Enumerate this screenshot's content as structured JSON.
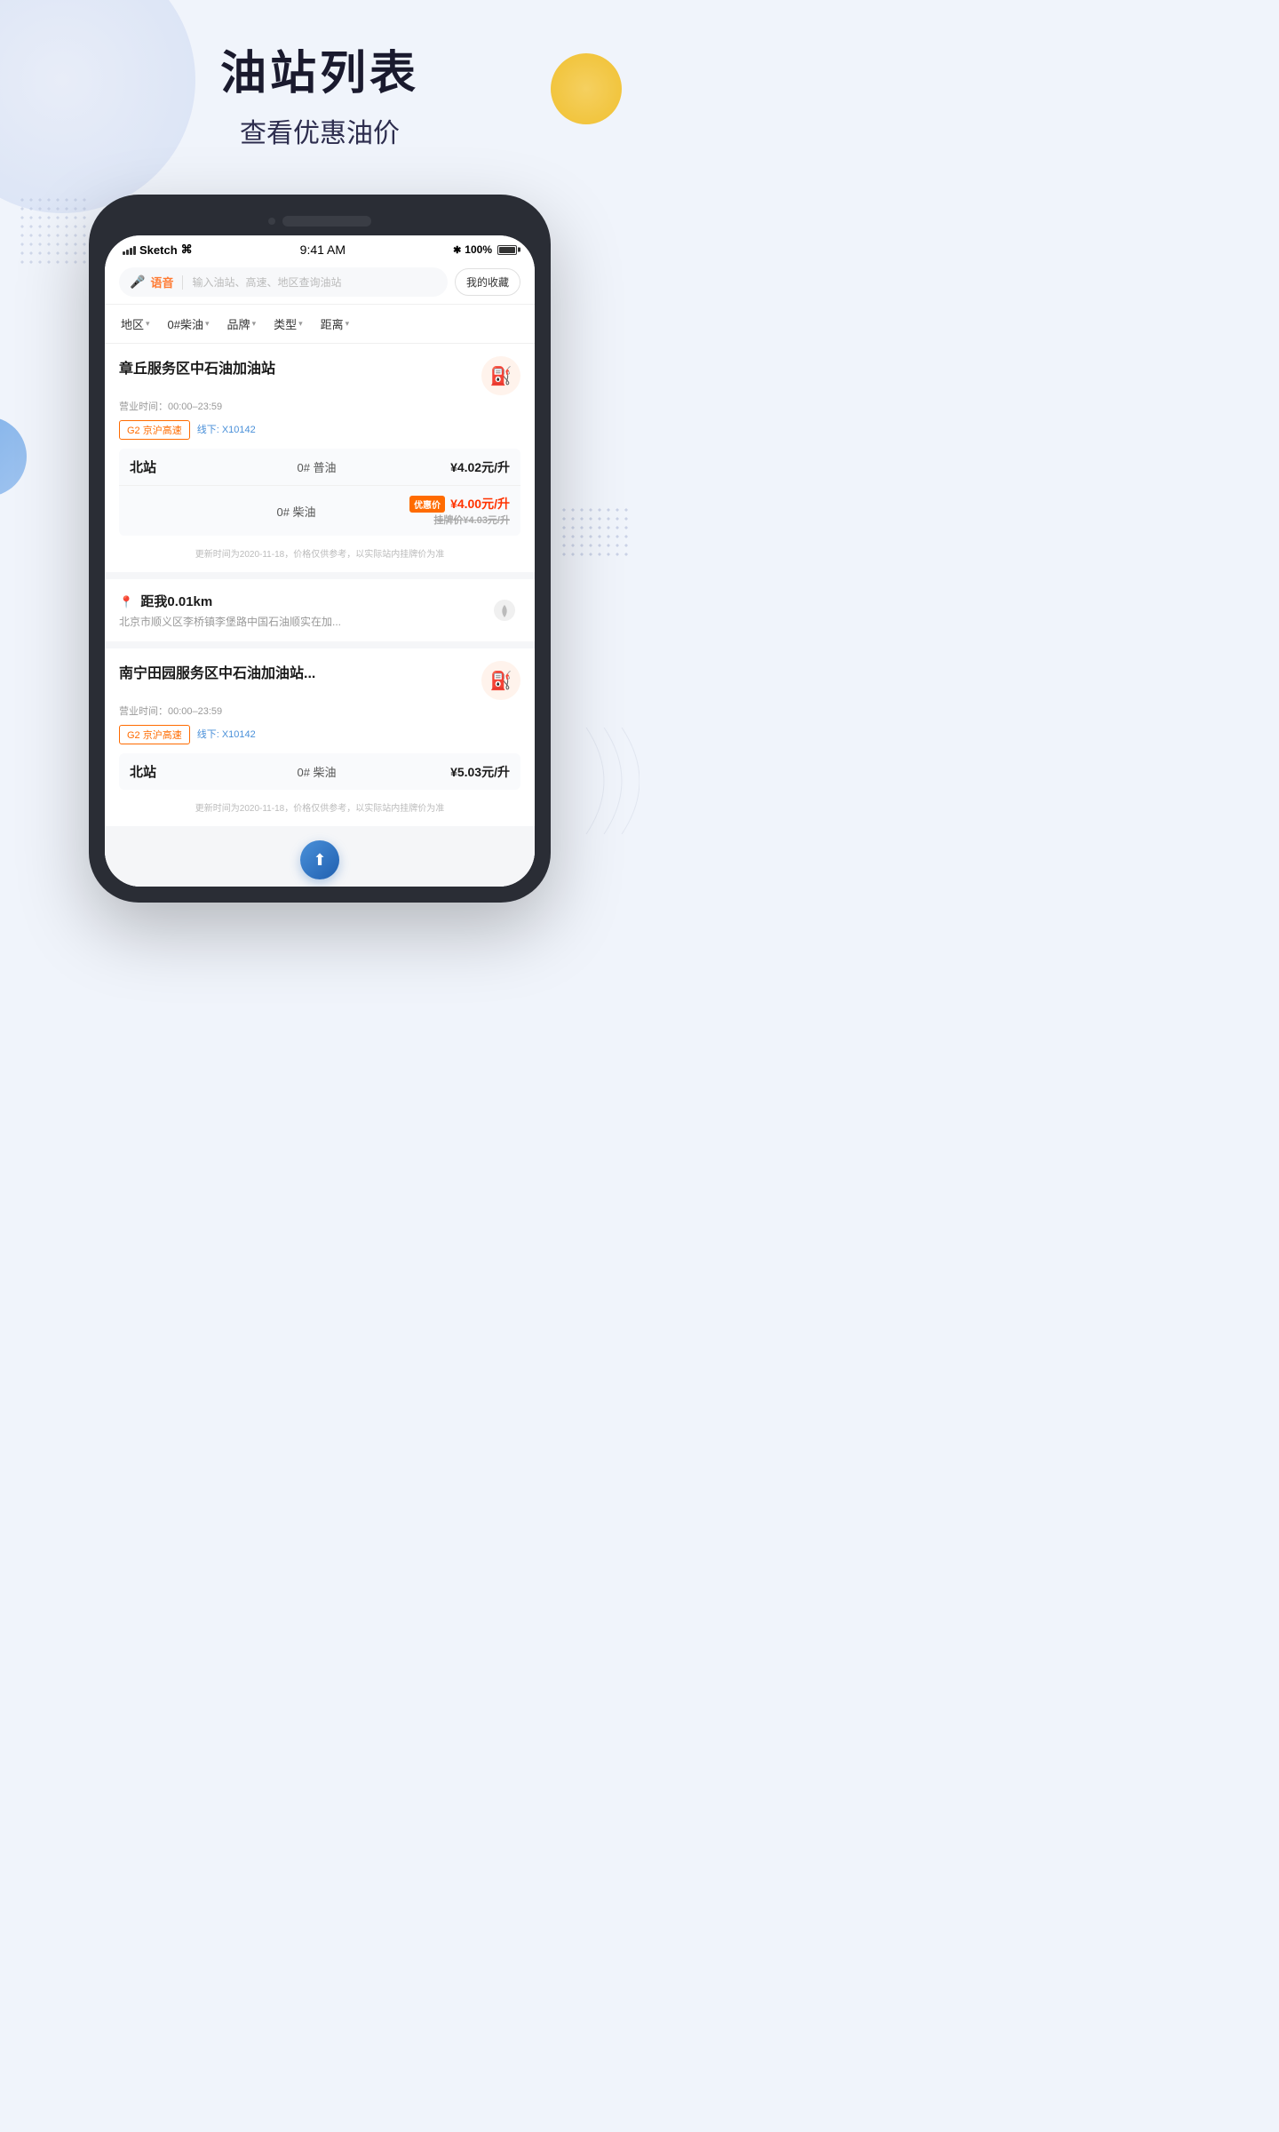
{
  "page": {
    "title": "油站列表",
    "subtitle": "查看优惠油价"
  },
  "status_bar": {
    "carrier": "Sketch",
    "time": "9:41 AM",
    "battery": "100%",
    "bluetooth": "✱"
  },
  "search": {
    "voice_label": "语音",
    "placeholder": "输入油站、高速、地区查询油站",
    "favorites_label": "我的收藏"
  },
  "filters": [
    {
      "label": "地区",
      "id": "region"
    },
    {
      "label": "0#柴油",
      "id": "fuel-type"
    },
    {
      "label": "品牌",
      "id": "brand"
    },
    {
      "label": "类型",
      "id": "type"
    },
    {
      "label": "距离",
      "id": "distance"
    }
  ],
  "stations": [
    {
      "id": "station-1",
      "name": "章丘服务区中石油加油站",
      "hours": "营业时间：00:00–23:59",
      "tag_highway": "G2 京沪高速",
      "tag_line": "线下: X10142",
      "sub_station": "北站",
      "prices": [
        {
          "fuel": "0# 普油",
          "value": "¥4.02元/升",
          "has_discount": false
        },
        {
          "fuel": "0# 柴油",
          "value": "¥4.00元/升",
          "has_discount": true,
          "discount_label": "优惠价",
          "original": "挂牌价¥4.03元/升"
        }
      ],
      "update_time": "更新时间为2020-11-18，价格仅供参考，以实际站内挂牌价为准"
    },
    {
      "id": "station-2",
      "name": "南宁田园服务区中石油加油站...",
      "hours": "营业时间：00:00–23:59",
      "tag_highway": "G2 京沪高速",
      "tag_line": "线下: X10142",
      "sub_station": "北站",
      "prices": [
        {
          "fuel": "0# 柴油",
          "value": "¥5.03元/升",
          "has_discount": false
        }
      ],
      "update_time": "更新时间为2020-11-18，价格仅供参考，以实际站内挂牌价为准"
    }
  ],
  "distance_card": {
    "distance": "距我0.01km",
    "address": "北京市顺义区李桥镇李堡路中国石油顺实在加..."
  },
  "icons": {
    "fuel_station": "⛽",
    "microphone": "🎤",
    "location_pin": "📍",
    "navigate": "🧭",
    "arrow_up": "↑"
  }
}
